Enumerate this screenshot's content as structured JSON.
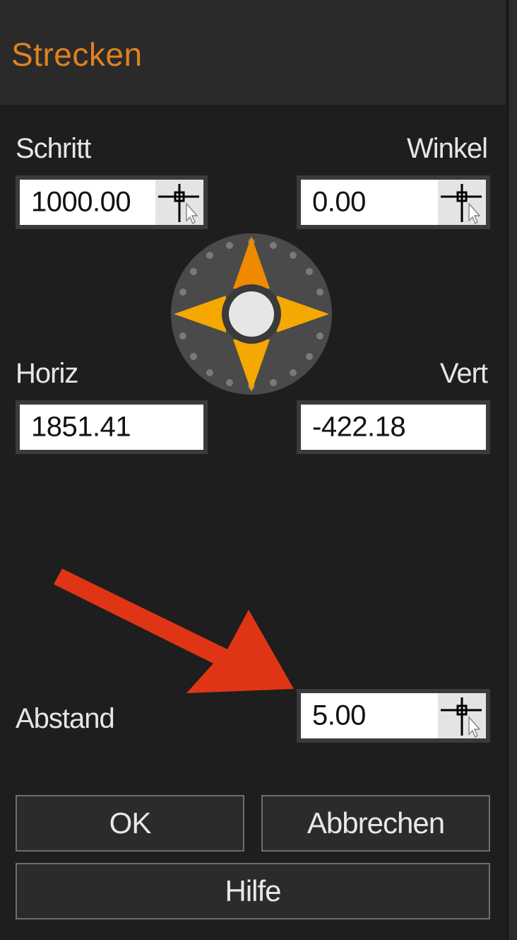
{
  "dialog": {
    "title": "Strecken"
  },
  "fields": {
    "schritt": {
      "label": "Schritt",
      "value": "1000.00"
    },
    "winkel": {
      "label": "Winkel",
      "value": "0.00"
    },
    "horiz": {
      "label": "Horiz",
      "value": "1851.41"
    },
    "vert": {
      "label": "Vert",
      "value": "-422.18"
    },
    "abstand": {
      "label": "Abstand",
      "value": "5.00"
    }
  },
  "buttons": {
    "ok": "OK",
    "cancel": "Abbrechen",
    "help": "Hilfe"
  },
  "icons": {
    "pick": "crosshair-cursor-icon",
    "compass": "direction-compass-icon",
    "annotation": "red-arrow-icon"
  },
  "colors": {
    "title": "#e0811f",
    "compass_north": "#ef8a00",
    "compass_other": "#f5a800",
    "annotation_arrow": "#e03515"
  }
}
